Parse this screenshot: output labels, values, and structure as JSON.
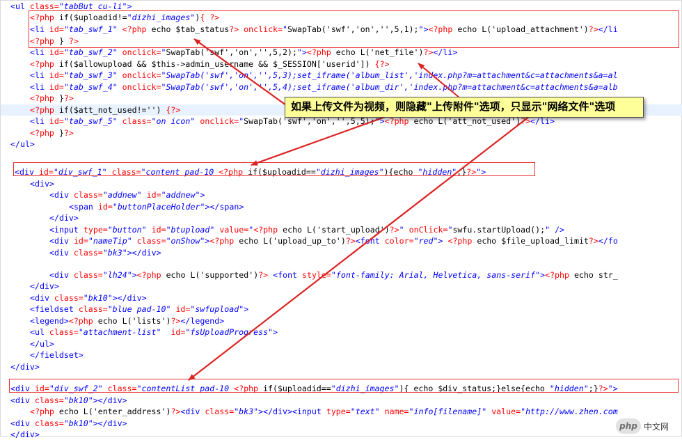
{
  "lines": [
    {
      "t": 0,
      "i": 0,
      "s": [
        [
          "tag",
          "<ul "
        ],
        [
          "attr",
          "class="
        ],
        [
          "val",
          "\"tabBut cu-li\""
        ],
        [
          "tag",
          ">"
        ]
      ]
    },
    {
      "t": 16,
      "i": 4,
      "s": [
        [
          "php",
          "<?php "
        ],
        [
          "ent",
          "if($uploadid!="
        ],
        [
          "val",
          "\"dizhi_images\""
        ],
        [
          "ent",
          ")"
        ],
        [
          "php",
          "{ ?>"
        ]
      ]
    },
    {
      "t": 33,
      "i": 4,
      "s": [
        [
          "tag",
          "<li "
        ],
        [
          "attr",
          "id="
        ],
        [
          "val",
          "\"tab_swf_1\" "
        ],
        [
          "php",
          "<?php "
        ],
        [
          "ent",
          "echo $tab_status"
        ],
        [
          "php",
          "?> "
        ],
        [
          "attr",
          "onclick="
        ],
        [
          "val",
          "\""
        ],
        [
          "ent",
          "SwapTab('swf','on','',5,1);"
        ],
        [
          "val",
          "\""
        ],
        [
          "tag",
          ">"
        ],
        [
          "php",
          "<?php "
        ],
        [
          "ent",
          "echo L('upload_attachment')"
        ],
        [
          "php",
          "?>"
        ],
        [
          "tag",
          "</li"
        ]
      ]
    },
    {
      "t": 50,
      "i": 4,
      "s": [
        [
          "php",
          "<?php "
        ],
        [
          "ent",
          "} "
        ],
        [
          "php",
          "?>"
        ]
      ]
    },
    {
      "t": 66,
      "i": 4,
      "s": [
        [
          "tag",
          "<li "
        ],
        [
          "attr",
          "id="
        ],
        [
          "val",
          "\"tab_swf_2\" "
        ],
        [
          "attr",
          "onclick="
        ],
        [
          "val",
          "\""
        ],
        [
          "ent",
          "SwapTab('swf','on','',5,2);"
        ],
        [
          "val",
          "\""
        ],
        [
          "tag",
          ">"
        ],
        [
          "php",
          "<?php "
        ],
        [
          "ent",
          "echo L('net_file')"
        ],
        [
          "php",
          "?>"
        ],
        [
          "tag",
          "</li>"
        ]
      ]
    },
    {
      "t": 83,
      "i": 4,
      "s": [
        [
          "php",
          "<?php "
        ],
        [
          "ent",
          "if($allowupload && $this->admin_username && $_SESSION['userid']) "
        ],
        [
          "php",
          "{?>"
        ]
      ]
    },
    {
      "t": 99,
      "i": 4,
      "s": [
        [
          "tag",
          "<li "
        ],
        [
          "attr",
          "id="
        ],
        [
          "val",
          "\"tab_swf_3\" "
        ],
        [
          "attr",
          "onclick="
        ],
        [
          "val",
          "\"SwapTab('swf','on','',5,3);set_iframe('album_list','index.php?m=attachment&c=attachments&a=al"
        ]
      ]
    },
    {
      "t": 116,
      "i": 4,
      "s": [
        [
          "tag",
          "<li "
        ],
        [
          "attr",
          "id="
        ],
        [
          "val",
          "\"tab_swf_4\" "
        ],
        [
          "attr",
          "onclick="
        ],
        [
          "val",
          "\"SwapTab('swf','on','',5,4);set_iframe('album_dir','index.php?m=attachment&c=attachments&a=alb"
        ]
      ]
    },
    {
      "t": 132,
      "i": 4,
      "s": [
        [
          "php",
          "<?php "
        ],
        [
          "ent",
          "}"
        ],
        [
          "php",
          "?>"
        ]
      ]
    },
    {
      "t": 149,
      "i": 4,
      "cur": true,
      "s": [
        [
          "php",
          "<?php "
        ],
        [
          "ent",
          "if($att_not_used!='') "
        ],
        [
          "php",
          "{?>"
        ]
      ]
    },
    {
      "t": 165,
      "i": 4,
      "s": [
        [
          "tag",
          "<li "
        ],
        [
          "attr",
          "id="
        ],
        [
          "val",
          "\"tab_swf_5\" "
        ],
        [
          "attr",
          "class="
        ],
        [
          "val",
          "\"on icon\" "
        ],
        [
          "attr",
          "onclick="
        ],
        [
          "val",
          "\""
        ],
        [
          "ent",
          "SwapTab('swf','on','',5,5);"
        ],
        [
          "val",
          "\""
        ],
        [
          "tag",
          ">"
        ],
        [
          "php",
          "<?php "
        ],
        [
          "ent",
          "echo L('att_not_used')"
        ],
        [
          "php",
          "?>"
        ],
        [
          "tag",
          "</li>"
        ]
      ]
    },
    {
      "t": 182,
      "i": 4,
      "s": [
        [
          "php",
          "<?php "
        ],
        [
          "ent",
          "}"
        ],
        [
          "php",
          "?>"
        ]
      ]
    },
    {
      "t": 198,
      "i": 0,
      "s": [
        [
          "tag",
          "</ul>"
        ]
      ]
    },
    {
      "t": 238,
      "i": 0,
      "pad": 6,
      "s": [
        [
          "tag",
          "<div "
        ],
        [
          "attr",
          "id="
        ],
        [
          "val",
          "\"div_swf_1\" "
        ],
        [
          "attr",
          "class="
        ],
        [
          "val",
          "\"content pad-10 "
        ],
        [
          "php",
          "<?php "
        ],
        [
          "ent",
          "if($uploadid=="
        ],
        [
          "val",
          "\"dizhi_images\""
        ],
        [
          "ent",
          "){echo "
        ],
        [
          "val",
          "\"hidden\""
        ],
        [
          "ent",
          ";}"
        ],
        [
          "php",
          "?>"
        ],
        [
          "val",
          "\""
        ],
        [
          "tag",
          ">"
        ]
      ]
    },
    {
      "t": 255,
      "i": 4,
      "s": [
        [
          "tag",
          "<div>"
        ]
      ]
    },
    {
      "t": 271,
      "i": 8,
      "s": [
        [
          "tag",
          "<div "
        ],
        [
          "attr",
          "class="
        ],
        [
          "val",
          "\"addnew\" "
        ],
        [
          "attr",
          "id="
        ],
        [
          "val",
          "\"addnew\""
        ],
        [
          "tag",
          ">"
        ]
      ]
    },
    {
      "t": 288,
      "i": 12,
      "s": [
        [
          "tag",
          "<span "
        ],
        [
          "attr",
          "id="
        ],
        [
          "val",
          "\"buttonPlaceHolder\""
        ],
        [
          "tag",
          "></span>"
        ]
      ]
    },
    {
      "t": 304,
      "i": 8,
      "s": [
        [
          "tag",
          "</div>"
        ]
      ]
    },
    {
      "t": 321,
      "i": 8,
      "s": [
        [
          "tag",
          "<input "
        ],
        [
          "attr",
          "type="
        ],
        [
          "val",
          "\"button\" "
        ],
        [
          "attr",
          "id="
        ],
        [
          "val",
          "\"btupload\" "
        ],
        [
          "attr",
          "value="
        ],
        [
          "val",
          "\""
        ],
        [
          "php",
          "<?php "
        ],
        [
          "ent",
          "echo L('start_upload')"
        ],
        [
          "php",
          "?>"
        ],
        [
          "val",
          "\" "
        ],
        [
          "attr",
          "onClick="
        ],
        [
          "val",
          "\""
        ],
        [
          "ent",
          "swfu.startUpload();"
        ],
        [
          "val",
          "\""
        ],
        [
          "tag",
          " />"
        ]
      ]
    },
    {
      "t": 337,
      "i": 8,
      "s": [
        [
          "tag",
          "<div "
        ],
        [
          "attr",
          "id="
        ],
        [
          "val",
          "\"nameTip\" "
        ],
        [
          "attr",
          "class="
        ],
        [
          "val",
          "\"onShow\""
        ],
        [
          "tag",
          ">"
        ],
        [
          "php",
          "<?php "
        ],
        [
          "ent",
          "echo L('upload_up_to')"
        ],
        [
          "php",
          "?>"
        ],
        [
          "tag",
          "<font "
        ],
        [
          "attr",
          "color="
        ],
        [
          "val",
          "\"red\""
        ],
        [
          "tag",
          "> "
        ],
        [
          "php",
          "<?php "
        ],
        [
          "ent",
          "echo $file_upload_limit"
        ],
        [
          "php",
          "?>"
        ],
        [
          "tag",
          "</fo"
        ]
      ]
    },
    {
      "t": 354,
      "i": 8,
      "s": [
        [
          "tag",
          "<div "
        ],
        [
          "attr",
          "class="
        ],
        [
          "val",
          "\"bk3\""
        ],
        [
          "tag",
          "></div>"
        ]
      ]
    },
    {
      "t": 386,
      "i": 8,
      "s": [
        [
          "tag",
          "<div "
        ],
        [
          "attr",
          "class="
        ],
        [
          "val",
          "\"lh24\""
        ],
        [
          "tag",
          ">"
        ],
        [
          "php",
          "<?php "
        ],
        [
          "ent",
          "echo L('supported')"
        ],
        [
          "php",
          "?> "
        ],
        [
          "tag",
          "<font "
        ],
        [
          "attr",
          "style="
        ],
        [
          "val",
          "\"font-family: Arial, Helvetica, sans-serif\""
        ],
        [
          "tag",
          ">"
        ],
        [
          "php",
          "<?php "
        ],
        [
          "ent",
          "echo str_"
        ]
      ]
    },
    {
      "t": 402,
      "i": 4,
      "s": [
        [
          "tag",
          "</div>"
        ]
      ]
    },
    {
      "t": 419,
      "i": 4,
      "s": [
        [
          "tag",
          "<div "
        ],
        [
          "attr",
          "class="
        ],
        [
          "val",
          "\"bk10\""
        ],
        [
          "tag",
          "></div>"
        ]
      ]
    },
    {
      "t": 435,
      "i": 4,
      "s": [
        [
          "tag",
          "<fieldset "
        ],
        [
          "attr",
          "class="
        ],
        [
          "val",
          "\"blue pad-10\" "
        ],
        [
          "attr",
          "id="
        ],
        [
          "val",
          "\"swfupload\""
        ],
        [
          "tag",
          ">"
        ]
      ]
    },
    {
      "t": 452,
      "i": 4,
      "s": [
        [
          "tag",
          "<legend>"
        ],
        [
          "php",
          "<?php "
        ],
        [
          "ent",
          "echo L('lists')"
        ],
        [
          "php",
          "?>"
        ],
        [
          "tag",
          "</legend>"
        ]
      ]
    },
    {
      "t": 468,
      "i": 4,
      "s": [
        [
          "tag",
          "<ul "
        ],
        [
          "attr",
          "class="
        ],
        [
          "val",
          "\"attachment-list\"  "
        ],
        [
          "attr",
          "id="
        ],
        [
          "val",
          "\"fsUploadProgress\""
        ],
        [
          "tag",
          ">"
        ]
      ]
    },
    {
      "t": 485,
      "i": 4,
      "s": [
        [
          "tag",
          "</ul>"
        ]
      ]
    },
    {
      "t": 501,
      "i": 4,
      "s": [
        [
          "tag",
          "</fieldset>"
        ]
      ]
    },
    {
      "t": 518,
      "i": 0,
      "s": [
        [
          "tag",
          "</div>"
        ]
      ]
    },
    {
      "t": 549,
      "i": 0,
      "s": [
        [
          "tag",
          "<div "
        ],
        [
          "attr",
          "id="
        ],
        [
          "val",
          "\"div_swf_2\" "
        ],
        [
          "attr",
          "class="
        ],
        [
          "val",
          "\"contentList pad-10 "
        ],
        [
          "php",
          "<?php "
        ],
        [
          "ent",
          "if($uploadid=="
        ],
        [
          "val",
          "\"dizhi_images\""
        ],
        [
          "ent",
          "){ echo $div_status;}else{echo "
        ],
        [
          "val",
          "\"hidden\""
        ],
        [
          "ent",
          ";}"
        ],
        [
          "php",
          "?>"
        ],
        [
          "val",
          "\""
        ],
        [
          "tag",
          ">"
        ]
      ]
    },
    {
      "t": 566,
      "i": 0,
      "s": [
        [
          "tag",
          "<div "
        ],
        [
          "attr",
          "class="
        ],
        [
          "val",
          "\"bk10\""
        ],
        [
          "tag",
          "></div>"
        ]
      ]
    },
    {
      "t": 582,
      "i": 4,
      "s": [
        [
          "php",
          "<?php "
        ],
        [
          "ent",
          "echo L('enter_address')"
        ],
        [
          "php",
          "?>"
        ],
        [
          "tag",
          "<div "
        ],
        [
          "attr",
          "class="
        ],
        [
          "val",
          "\"bk3\""
        ],
        [
          "tag",
          "></div><input "
        ],
        [
          "attr",
          "type="
        ],
        [
          "val",
          "\"text\" "
        ],
        [
          "attr",
          "name="
        ],
        [
          "val",
          "\"info[filename]\" "
        ],
        [
          "attr",
          "value="
        ],
        [
          "val",
          "\"http://www.zhen.com"
        ]
      ]
    },
    {
      "t": 599,
      "i": 0,
      "s": [
        [
          "tag",
          "<div "
        ],
        [
          "attr",
          "class="
        ],
        [
          "val",
          "\"bk10\""
        ],
        [
          "tag",
          "></div>"
        ]
      ]
    },
    {
      "t": 615,
      "i": 0,
      "s": [
        [
          "tag",
          "</div>"
        ]
      ]
    }
  ],
  "callout": {
    "text": "如果上传文件为视频，则隐藏\"上传附件\"选项，只显示\"网络文件\"选项"
  },
  "watermark": {
    "logo": "php",
    "label": "中文网"
  },
  "colors": {
    "tag": "#0000ff",
    "attr": "#ff0000",
    "php": "#ff0000",
    "highlight_box": "#e83030",
    "arrow": "#dd2222",
    "callout_bg": "#ffff9a",
    "current_line": "#e8f2fe"
  }
}
